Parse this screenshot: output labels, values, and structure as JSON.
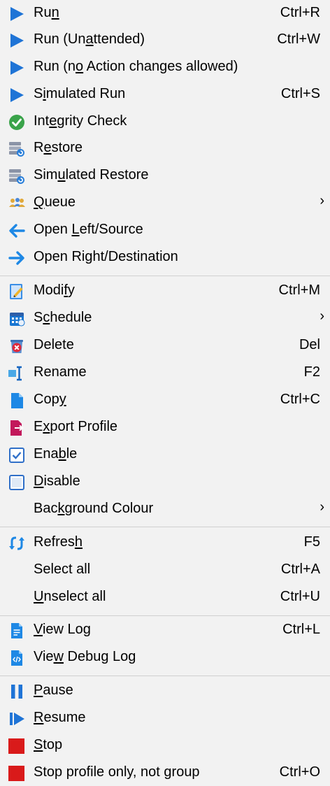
{
  "menu": {
    "items": [
      {
        "id": "run",
        "icon": "play-icon",
        "pre": "Ru",
        "ul": "n",
        "post": "",
        "shortcut": "Ctrl+R"
      },
      {
        "id": "run-unattended",
        "icon": "play-icon",
        "pre": "Run (Un",
        "ul": "a",
        "post": "ttended)",
        "shortcut": "Ctrl+W"
      },
      {
        "id": "run-no-action-changes",
        "icon": "play-icon",
        "pre": "Run (n",
        "ul": "o",
        "post": " Action changes allowed)",
        "shortcut": ""
      },
      {
        "id": "simulated-run",
        "icon": "play-icon",
        "pre": "S",
        "ul": "i",
        "post": "mulated Run",
        "shortcut": "Ctrl+S"
      },
      {
        "id": "integrity-check",
        "icon": "check-circle-icon",
        "pre": "Int",
        "ul": "e",
        "post": "grity Check",
        "shortcut": ""
      },
      {
        "id": "restore",
        "icon": "restore-icon",
        "pre": "R",
        "ul": "e",
        "post": "store",
        "shortcut": ""
      },
      {
        "id": "simulated-restore",
        "icon": "restore-icon",
        "pre": "Sim",
        "ul": "u",
        "post": "lated Restore",
        "shortcut": ""
      },
      {
        "id": "queue",
        "icon": "queue-icon",
        "pre": "",
        "ul": "Q",
        "post": "ueue",
        "shortcut": "",
        "submenu": true
      },
      {
        "id": "open-left-source",
        "icon": "arrow-left-icon",
        "pre": "Open ",
        "ul": "L",
        "post": "eft/Source",
        "shortcut": ""
      },
      {
        "id": "open-right-destination",
        "icon": "arrow-right-icon",
        "pre": "Open Ri",
        "ul": "g",
        "post": "ht/Destination",
        "shortcut": ""
      },
      {
        "id": "modify",
        "icon": "edit-icon",
        "pre": "Modi",
        "ul": "f",
        "post": "y",
        "shortcut": "Ctrl+M"
      },
      {
        "id": "schedule",
        "icon": "calendar-icon",
        "pre": "S",
        "ul": "c",
        "post": "hedule",
        "shortcut": "",
        "submenu": true
      },
      {
        "id": "delete",
        "icon": "delete-icon",
        "pre": "Delete",
        "ul": "",
        "post": "",
        "shortcut": "Del"
      },
      {
        "id": "rename",
        "icon": "rename-icon",
        "pre": "Rename",
        "ul": "",
        "post": "",
        "shortcut": "F2"
      },
      {
        "id": "copy",
        "icon": "copy-icon",
        "pre": "Cop",
        "ul": "y",
        "post": "",
        "shortcut": "Ctrl+C"
      },
      {
        "id": "export-profile",
        "icon": "export-icon",
        "pre": "E",
        "ul": "x",
        "post": "port Profile",
        "shortcut": ""
      },
      {
        "id": "enable",
        "icon": "checkbox-checked-icon",
        "pre": "Ena",
        "ul": "b",
        "post": "le",
        "shortcut": ""
      },
      {
        "id": "disable",
        "icon": "checkbox-empty-icon",
        "pre": "",
        "ul": "D",
        "post": "isable",
        "shortcut": ""
      },
      {
        "id": "background-colour",
        "icon": "",
        "pre": "Bac",
        "ul": "k",
        "post": "ground Colour",
        "shortcut": "",
        "submenu": true
      },
      {
        "id": "refresh",
        "icon": "refresh-icon",
        "pre": "Refres",
        "ul": "h",
        "post": "",
        "shortcut": "F5"
      },
      {
        "id": "select-all",
        "icon": "",
        "pre": "Select all",
        "ul": "",
        "post": "",
        "shortcut": "Ctrl+A"
      },
      {
        "id": "unselect-all",
        "icon": "",
        "pre": "",
        "ul": "U",
        "post": "nselect all",
        "shortcut": "Ctrl+U"
      },
      {
        "id": "view-log",
        "icon": "log-icon",
        "pre": "",
        "ul": "V",
        "post": "iew Log",
        "shortcut": "Ctrl+L"
      },
      {
        "id": "view-debug-log",
        "icon": "debug-log-icon",
        "pre": "Vie",
        "ul": "w",
        "post": " Debug Log",
        "shortcut": ""
      },
      {
        "id": "pause",
        "icon": "pause-icon",
        "pre": "",
        "ul": "P",
        "post": "ause",
        "shortcut": ""
      },
      {
        "id": "resume",
        "icon": "resume-icon",
        "pre": "",
        "ul": "R",
        "post": "esume",
        "shortcut": ""
      },
      {
        "id": "stop",
        "icon": "stop-icon",
        "pre": "",
        "ul": "S",
        "post": "top",
        "shortcut": ""
      },
      {
        "id": "stop-profile-only",
        "icon": "stop-icon",
        "pre": "Stop profile only, not group",
        "ul": "",
        "post": "",
        "shortcut": "Ctrl+O"
      }
    ],
    "submenu_arrow": "›"
  },
  "colors": {
    "background": "#f2f2f2",
    "separator": "#d0d0d0",
    "play": "#1f74d6",
    "check": "#3aa34a",
    "stop": "#d91a1a"
  }
}
